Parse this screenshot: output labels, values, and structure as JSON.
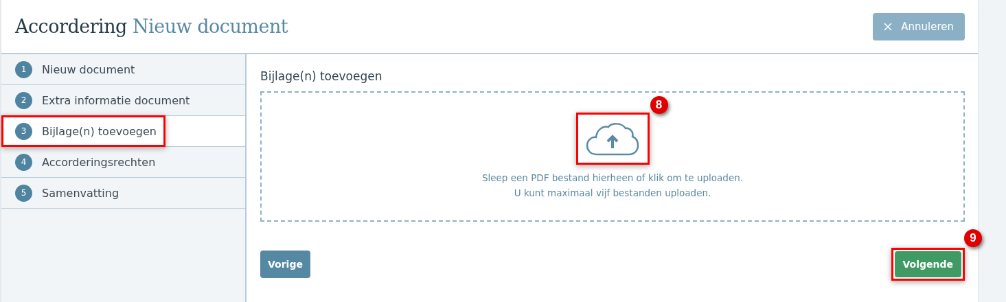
{
  "header": {
    "title": "Accordering",
    "subtitle": "Nieuw document",
    "cancel_button": "Annuleren"
  },
  "steps": [
    {
      "number": "1",
      "label": "Nieuw document",
      "selected": false,
      "highlighted": false
    },
    {
      "number": "2",
      "label": "Extra informatie document",
      "selected": false,
      "highlighted": false
    },
    {
      "number": "3",
      "label": "Bijlage(n) toevoegen",
      "selected": true,
      "highlighted": true
    },
    {
      "number": "4",
      "label": "Accorderingsrechten",
      "selected": false,
      "highlighted": false
    },
    {
      "number": "5",
      "label": "Samenvatting",
      "selected": false,
      "highlighted": false
    }
  ],
  "content": {
    "heading": "Bijlage(n) toevoegen",
    "dropzone": {
      "upload_highlighted": true,
      "badge": "8",
      "lines": [
        "Sleep een PDF bestand hierheen of klik om te uploaden.",
        "U kunt maximaal vijf bestanden uploaden."
      ]
    },
    "previous_button": {
      "label": "Vorige"
    },
    "next_button": {
      "label": "Volgende",
      "highlighted": true,
      "badge": "9"
    }
  }
}
